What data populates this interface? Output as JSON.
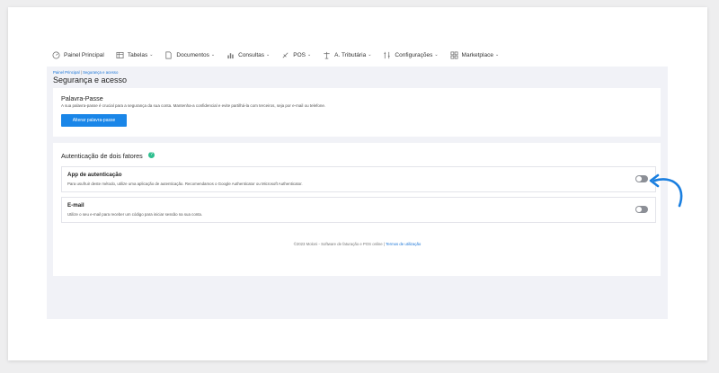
{
  "nav": [
    {
      "label": "Painel Principal",
      "icon": "dashboard-icon",
      "dropdown": false
    },
    {
      "label": "Tabelas",
      "icon": "table-icon",
      "dropdown": true
    },
    {
      "label": "Documentos",
      "icon": "document-icon",
      "dropdown": true
    },
    {
      "label": "Consultas",
      "icon": "chart-icon",
      "dropdown": true
    },
    {
      "label": "POS",
      "icon": "pos-icon",
      "dropdown": true
    },
    {
      "label": "A. Tributária",
      "icon": "scale-icon",
      "dropdown": true
    },
    {
      "label": "Configurações",
      "icon": "tools-icon",
      "dropdown": true
    },
    {
      "label": "Marketplace",
      "icon": "grid-icon",
      "dropdown": true
    }
  ],
  "breadcrumb": {
    "home": "Painel Principal",
    "separator": "|",
    "current": "Segurança e acesso"
  },
  "page_title": "Segurança e acesso",
  "password": {
    "title": "Palavra-Passe",
    "description": "A sua palavra-passe é crucial para a segurança da sua conta. Mantenha-a confidencial e evite partilhá-la com terceiros, seja por e-mail ou telefone.",
    "button_label": "Alterar palavra-passe"
  },
  "two_factor": {
    "title": "Autenticação de dois fatores",
    "help_symbol": "?",
    "options": [
      {
        "title": "App de autenticação",
        "description": "Para usufruir deste método, utilize uma aplicação de autenticação. Recomendamos o Google Authenticator ou Microsoft Authenticator.",
        "enabled": false
      },
      {
        "title": "E-mail",
        "description": "Utilize o seu e-mail para receber um código para iniciar sessão na sua conta.",
        "enabled": false
      }
    ]
  },
  "footer": {
    "text": "©2023 Moloni - Software de faturação e POS online |",
    "link": "Termos de utilização"
  },
  "colors": {
    "primary": "#1a86e8",
    "help": "#2fbf8f",
    "arrow": "#1a7fe0",
    "toggle_off": "#8c8f96"
  }
}
